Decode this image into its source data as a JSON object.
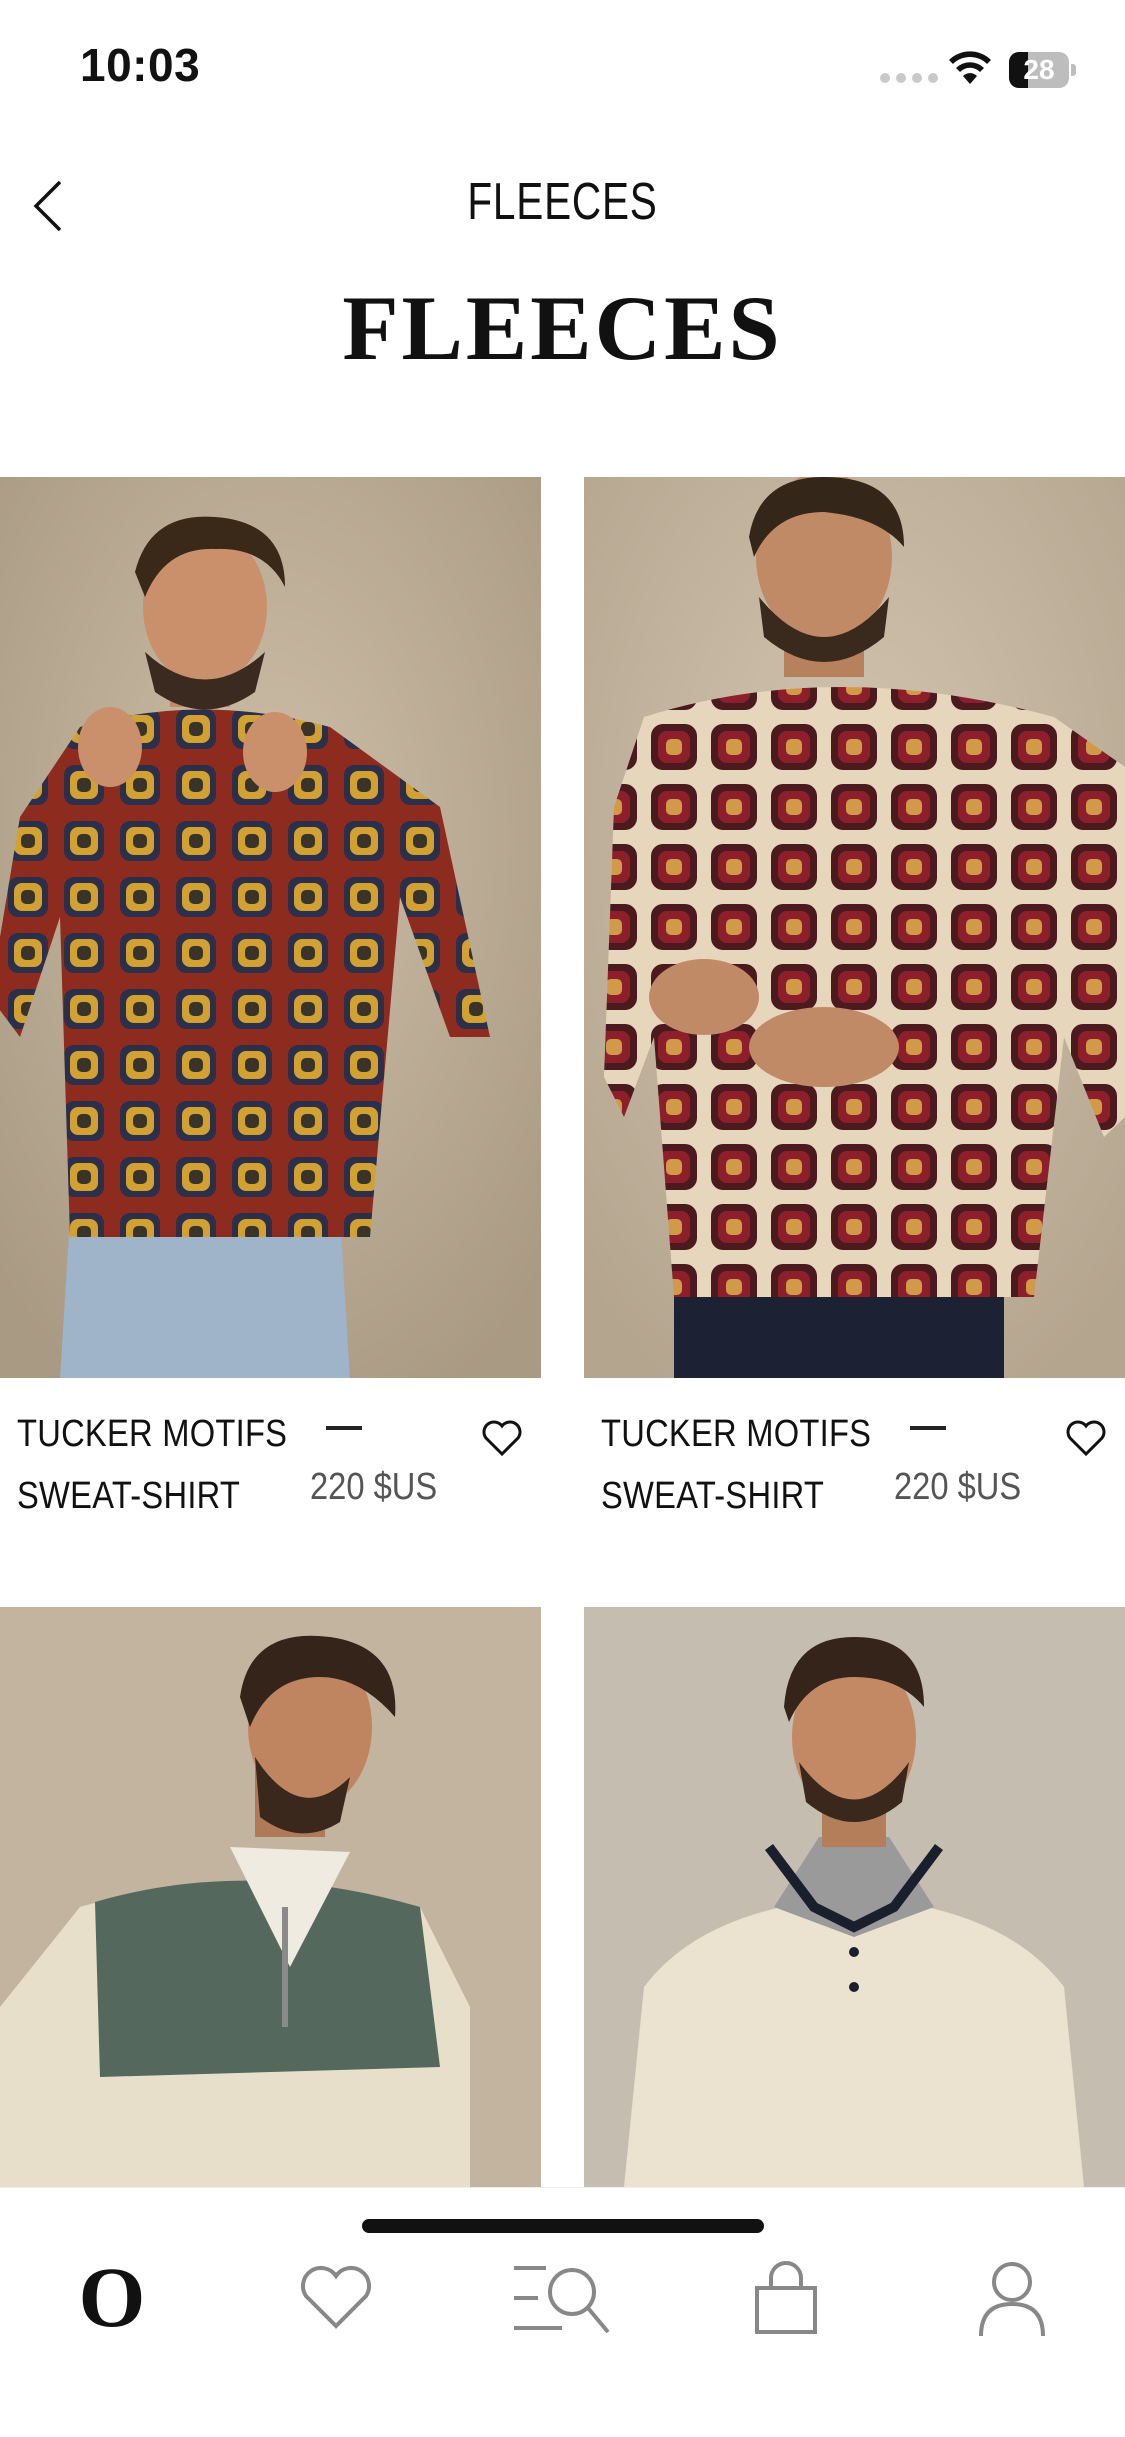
{
  "status_bar": {
    "time": "10:03",
    "battery_level": "28",
    "signal_icon": "signal-dots-icon",
    "wifi_icon": "wifi-icon",
    "battery_icon": "battery-icon"
  },
  "header": {
    "nav_title": "FLEECES",
    "back_icon": "chevron-left-icon"
  },
  "page_title": "FLEECES",
  "products": [
    {
      "name_line1": "TUCKER MOTIFS",
      "name_line2": "SWEAT-SHIRT",
      "price": "220 $US",
      "sweater_color": "#8e2b1f",
      "motif_color": "#d1a233",
      "favorite_icon": "heart-outline-icon"
    },
    {
      "name_line1": "TUCKER MOTIFS",
      "name_line2": "SWEAT-SHIRT",
      "price": "220 $US",
      "sweater_color": "#e6d6bb",
      "motif_color": "#8d1f2b",
      "favorite_icon": "heart-outline-icon"
    },
    {
      "sweater_color": "#e8dfcb",
      "panel_color": "#54685e"
    },
    {
      "sweater_color": "#ebe2cf",
      "trim_color": "#1a1f2e"
    }
  ],
  "tab_bar": {
    "items": [
      {
        "icon": "brand-logo-icon",
        "label": "O"
      },
      {
        "icon": "heart-icon"
      },
      {
        "icon": "search-menu-icon"
      },
      {
        "icon": "shopping-bag-icon"
      },
      {
        "icon": "profile-icon"
      }
    ]
  },
  "colors": {
    "background": "#ffffff",
    "text": "#111111",
    "price_text": "#555555",
    "photo_backdrop": "#c8b9a3"
  }
}
